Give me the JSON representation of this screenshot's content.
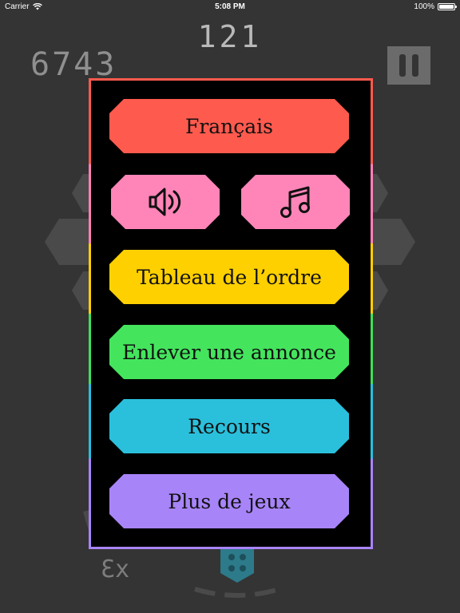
{
  "status_bar": {
    "carrier": "Carrier",
    "time": "5:08 PM",
    "battery": "100%"
  },
  "game": {
    "level": "121",
    "score": "6743",
    "multiplier": "x3"
  },
  "menu": {
    "language_label": "Français",
    "leaderboard_label": "Tableau de l’ordre",
    "remove_ads_label": "Enlever une annonce",
    "restore_label": "Recours",
    "more_games_label": "Plus de jeux"
  },
  "colors": {
    "language": "#ff5a4e",
    "sound": "#ff85b8",
    "leaderboard": "#ffd000",
    "remove_ads": "#44e55d",
    "restore": "#2ac0dc",
    "more_games": "#a884f9"
  },
  "icons": {
    "sound": "speaker-icon",
    "music": "music-note-icon",
    "wifi": "wifi-icon",
    "battery": "battery-icon",
    "pause": "pause-icon"
  }
}
